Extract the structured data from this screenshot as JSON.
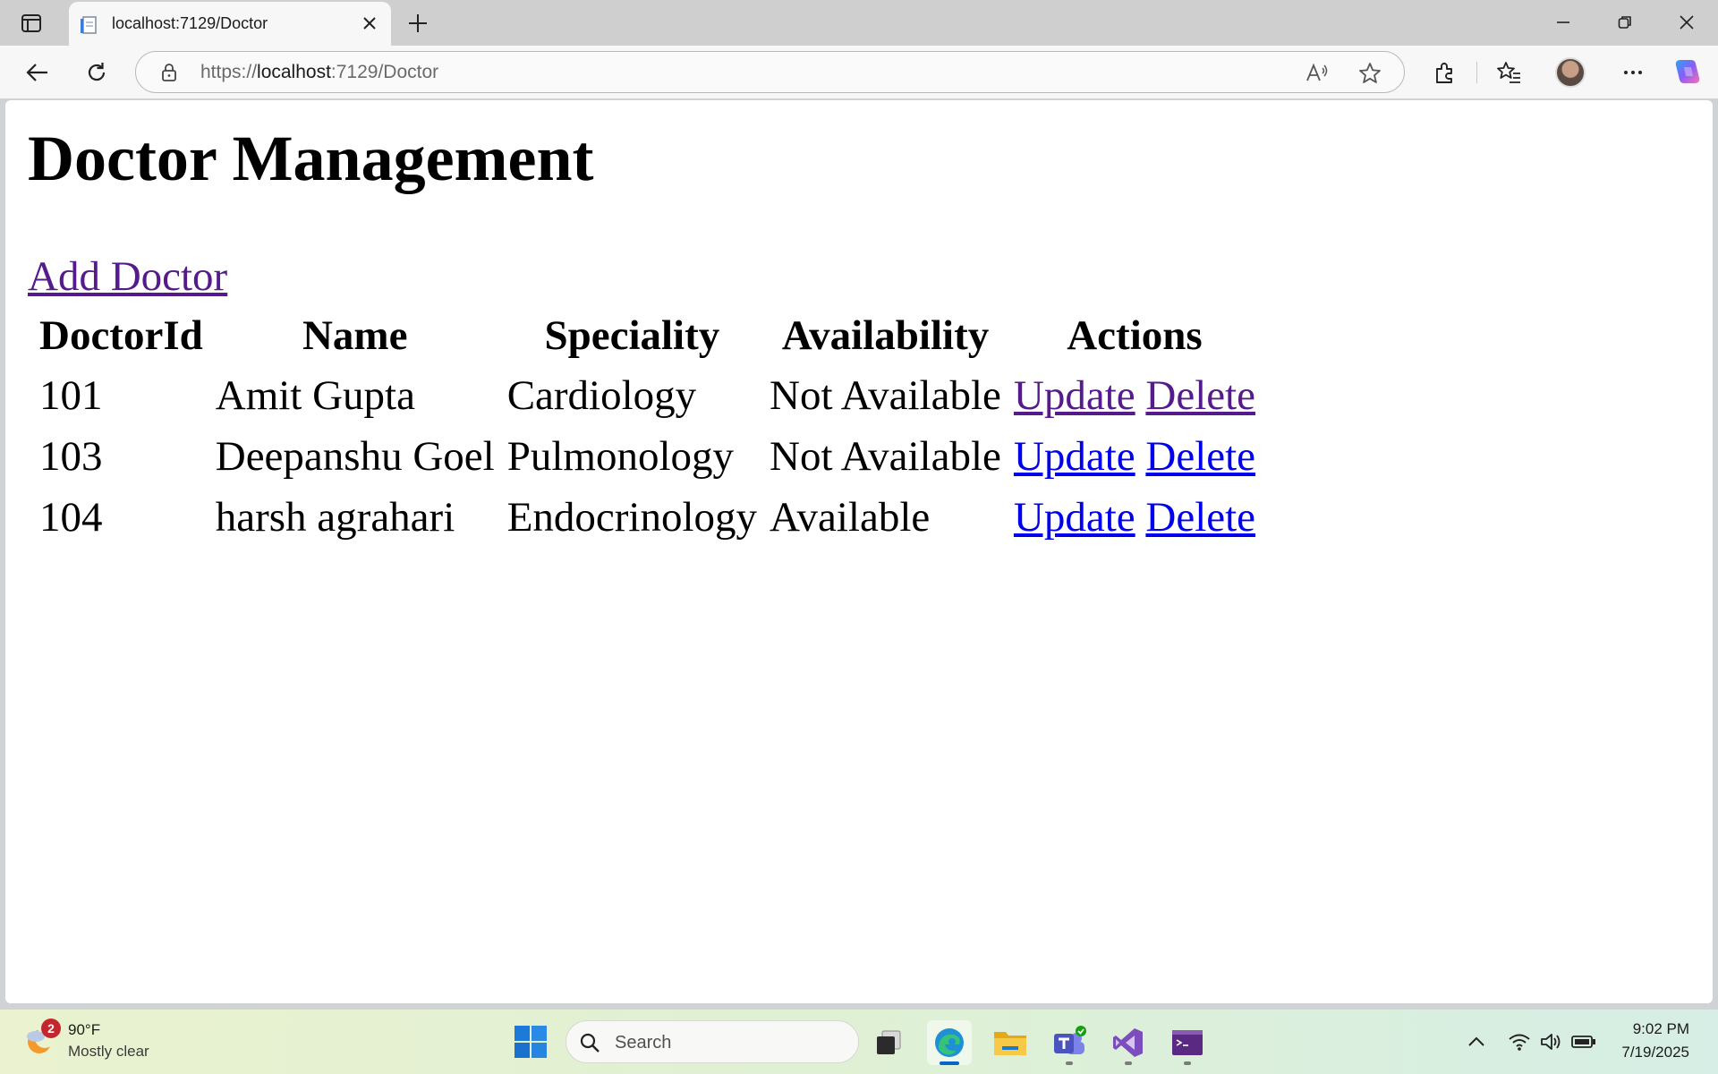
{
  "browser": {
    "tab": {
      "title": "localhost:7129/Doctor"
    },
    "address": {
      "scheme": "https://",
      "host": "localhost",
      "path": ":7129/Doctor"
    }
  },
  "page": {
    "title": "Doctor Management",
    "add_link": "Add Doctor",
    "table": {
      "headers": [
        "DoctorId",
        "Name",
        "Speciality",
        "Availability",
        "Actions"
      ],
      "rows": [
        {
          "id": "101",
          "name": "Amit Gupta",
          "speciality": "Cardiology",
          "availability": "Not Available",
          "update": "Update",
          "delete": "Delete"
        },
        {
          "id": "103",
          "name": "Deepanshu Goel",
          "speciality": "Pulmonology",
          "availability": "Not Available",
          "update": "Update",
          "delete": "Delete"
        },
        {
          "id": "104",
          "name": "harsh agrahari",
          "speciality": "Endocrinology",
          "availability": "Available",
          "update": "Update",
          "delete": "Delete"
        }
      ]
    }
  },
  "taskbar": {
    "weather": {
      "badge": "2",
      "temp": "90°F",
      "condition": "Mostly clear"
    },
    "search_label": "Search",
    "clock": {
      "time": "9:02 PM",
      "date": "7/19/2025"
    }
  },
  "colors": {
    "link_visited": "#551a8b",
    "link_unvisited": "#0000ee",
    "accent": "#0a64c8"
  }
}
